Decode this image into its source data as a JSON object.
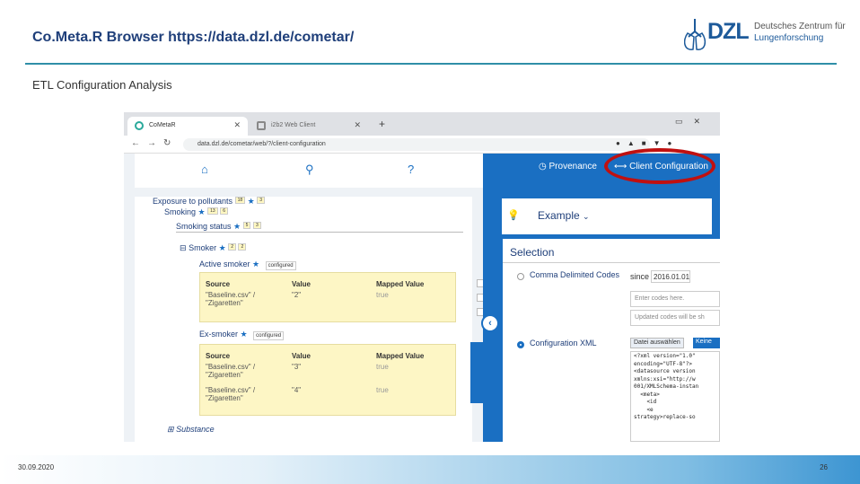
{
  "slide": {
    "title": "Co.Meta.R Browser https://data.dzl.de/cometar/",
    "subtitle": "ETL Configuration Analysis",
    "date": "30.09.2020",
    "page": "26"
  },
  "logo": {
    "brand": "DZL",
    "line1": "Deutsches Zentrum für",
    "line2": "Lungenforschung"
  },
  "browser": {
    "tabs": [
      {
        "label": "CoMetaR"
      },
      {
        "label": "i2b2 Web Client"
      }
    ],
    "url": "data.dzl.de/cometar/web/?/client-configuration"
  },
  "app": {
    "right_links": {
      "provenance": "Provenance",
      "client_config": "Client Configuration"
    },
    "tree": {
      "nodes": [
        {
          "label": "Exposure to pollutants",
          "count": "18",
          "badge": "3"
        },
        {
          "label": "Smoking",
          "count": "13",
          "badge": "6"
        },
        {
          "label": "Smoking status",
          "count": "5",
          "badge": "3"
        },
        {
          "label": "Smoker",
          "count": "2",
          "badge": "2"
        }
      ],
      "active_smoker": {
        "label": "Active smoker",
        "tag": "configured"
      },
      "ex_smoker": {
        "label": "Ex-smoker",
        "tag": "configured"
      },
      "substance": "Substance"
    },
    "columns": [
      "Source",
      "Value",
      "Mapped Value"
    ],
    "active_rows": [
      {
        "source": "\"Baseline.csv\" / \"Zigaretten\"",
        "value": "\"2\"",
        "mapped": "true"
      }
    ],
    "ex_rows": [
      {
        "source": "\"Baseline.csv\" / \"Zigaretten\"",
        "value": "\"3\"",
        "mapped": "true"
      },
      {
        "source": "\"Baseline.csv\" / \"Zigaretten\"",
        "value": "\"4\"",
        "mapped": "true"
      }
    ],
    "example": {
      "title": "Example",
      "selection": "Selection",
      "comma_option": "Comma Delimited Codes",
      "since_label": "since",
      "since_date": "2016.01.01",
      "enter_placeholder": "Enter codes here.",
      "updated_placeholder": "Updated codes will be sh",
      "xml_option": "Configuration XML",
      "file_button": "Datei auswählen",
      "second_button": "Keine",
      "xml_text": "<?xml version=\"1.0\"\nencoding=\"UTF-8\"?>\n<datasource version\nxmlns:xsi=\"http://w\n001/XMLSchema-instan\n  <meta>\n    <id\n    <e\nstrategy>replace-so"
    }
  }
}
